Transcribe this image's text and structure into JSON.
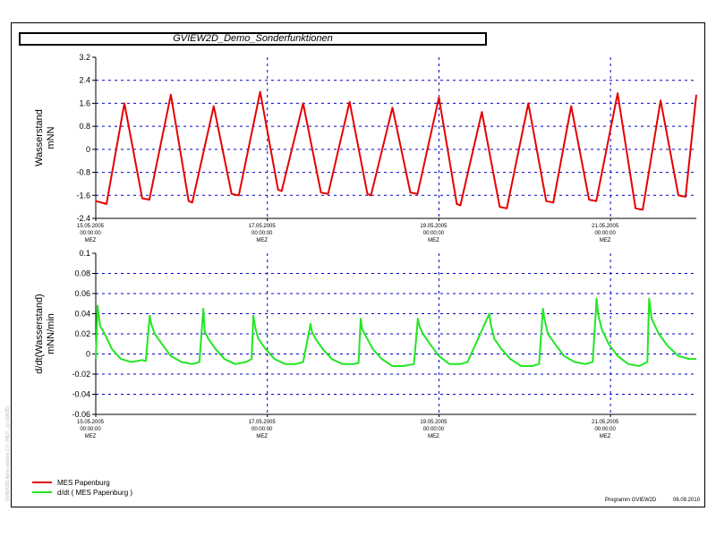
{
  "title": "GVIEW2D_Demo_Sonderfunktionen",
  "footer": {
    "program": "Programm GVIEW2D",
    "date": "06.09.2010"
  },
  "side_note": "GVIEW2D demo version 2.0 / INUT.. (c) GW/2D",
  "colors": {
    "level": "#e60000",
    "derivative": "#22e622",
    "grid": "#0000cc"
  },
  "chart_data": [
    {
      "type": "line",
      "ylabel": "Wasserstand\nmNN",
      "ylim": [
        -2.4,
        3.2
      ],
      "yticks": [
        "3.2",
        "2.4",
        "1.6",
        "0.8",
        "0",
        "-0.8",
        "-1.6",
        "-2.4"
      ],
      "xlim": [
        "15.05.2005 00:00",
        "22.05.2005 00:00"
      ],
      "xticks": [
        {
          "l1": "15.05.2005",
          "l2": "00:00:00",
          "l3": "MEZ"
        },
        {
          "l1": "17.05.2005",
          "l2": "00:00:00",
          "l3": "MEZ"
        },
        {
          "l1": "19.05.2005",
          "l2": "00:00:00",
          "l3": "MEZ"
        },
        {
          "l1": "21.05.2005",
          "l2": "00:00:00",
          "l3": "MEZ"
        }
      ],
      "grid": true,
      "series": [
        {
          "name": "MES Papenburg",
          "color": "#e60000",
          "x_hours": [
            0,
            3,
            8,
            13,
            15,
            21,
            26,
            27,
            33,
            38,
            40,
            46,
            51,
            52,
            58,
            63,
            65,
            71,
            76,
            77,
            83,
            88,
            90,
            96,
            101,
            102,
            108,
            113,
            115,
            121,
            126,
            128,
            133,
            138,
            140,
            146,
            151,
            153,
            158,
            163,
            165,
            168
          ],
          "values": [
            -1.8,
            -1.9,
            1.6,
            -1.7,
            -1.75,
            1.9,
            -1.8,
            -1.85,
            1.5,
            -1.55,
            -1.6,
            2.0,
            -1.4,
            -1.45,
            1.6,
            -1.5,
            -1.55,
            1.65,
            -1.55,
            -1.6,
            1.45,
            -1.5,
            -1.55,
            1.8,
            -1.9,
            -1.95,
            1.3,
            -2.0,
            -2.05,
            1.6,
            -1.8,
            -1.85,
            1.5,
            -1.75,
            -1.8,
            1.95,
            -2.05,
            -2.1,
            1.7,
            -1.6,
            -1.65,
            1.9
          ]
        }
      ]
    },
    {
      "type": "line",
      "ylabel": "d/dt(Wasserstand)\nmNN/min",
      "ylim": [
        -0.06,
        0.1
      ],
      "yticks": [
        "0.1",
        "0.08",
        "0.06",
        "0.04",
        "0.02",
        "0",
        "-0.02",
        "-0.04",
        "-0.06"
      ],
      "xlim": [
        "15.05.2005 00:00",
        "22.05.2005 00:00"
      ],
      "xticks": [
        {
          "l1": "15.05.2005",
          "l2": "00:00:00",
          "l3": "MEZ"
        },
        {
          "l1": "17.05.2005",
          "l2": "00:00:00",
          "l3": "MEZ"
        },
        {
          "l1": "19.05.2005",
          "l2": "00:00:00",
          "l3": "MEZ"
        },
        {
          "l1": "21.05.2005",
          "l2": "00:00:00",
          "l3": "MEZ"
        }
      ],
      "grid": true,
      "series": [
        {
          "name": "d/dt ( MES Papenburg )",
          "color": "#22e622",
          "x_hours": [
            0,
            0.5,
            1.2,
            2.5,
            4.5,
            7,
            10,
            13,
            14,
            15.1,
            15.5,
            16.5,
            18.5,
            21,
            24,
            27,
            29,
            30.1,
            30.5,
            31.5,
            33.5,
            36,
            39,
            42,
            43.6,
            44.1,
            44.7,
            45.5,
            47.5,
            50,
            53,
            56,
            58,
            60.1,
            60.5,
            61.5,
            63.5,
            66,
            69,
            72,
            73.5,
            74.1,
            74.5,
            75.5,
            77.5,
            80,
            83,
            86,
            89,
            90.1,
            90.5,
            91.5,
            93.5,
            96,
            99,
            102,
            104,
            110.1,
            110.5,
            111.5,
            113.5,
            116,
            119,
            122,
            124,
            125.1,
            125.5,
            126.5,
            128.5,
            131,
            134,
            137,
            139,
            140.1,
            140.5,
            141.5,
            143.5,
            146,
            149,
            152,
            154.3,
            154.8,
            155.5,
            157.5,
            160,
            163,
            166,
            168
          ],
          "values": [
            -0.005,
            0.048,
            0.028,
            0.02,
            0.005,
            -0.005,
            -0.008,
            -0.006,
            -0.007,
            0.038,
            0.03,
            0.02,
            0.01,
            -0.002,
            -0.008,
            -0.01,
            -0.008,
            0.045,
            0.022,
            0.015,
            0.005,
            -0.005,
            -0.01,
            -0.008,
            -0.005,
            0.038,
            0.025,
            0.015,
            0.005,
            -0.005,
            -0.01,
            -0.01,
            -0.008,
            0.03,
            0.022,
            0.015,
            0.005,
            -0.005,
            -0.01,
            -0.01,
            -0.009,
            0.035,
            0.025,
            0.018,
            0.005,
            -0.005,
            -0.012,
            -0.012,
            -0.01,
            0.035,
            0.028,
            0.02,
            0.01,
            -0.002,
            -0.01,
            -0.01,
            -0.008,
            0.04,
            0.03,
            0.015,
            0.005,
            -0.005,
            -0.012,
            -0.012,
            -0.01,
            0.045,
            0.035,
            0.02,
            0.01,
            -0.002,
            -0.008,
            -0.01,
            -0.008,
            0.055,
            0.04,
            0.025,
            0.01,
            -0.002,
            -0.01,
            -0.012,
            -0.008,
            0.055,
            0.035,
            0.02,
            0.008,
            -0.002,
            -0.005,
            -0.005
          ]
        }
      ]
    }
  ],
  "legend": [
    {
      "label": "MES Papenburg",
      "color": "#e60000"
    },
    {
      "label": "d/dt ( MES Papenburg )",
      "color": "#22e622"
    }
  ]
}
